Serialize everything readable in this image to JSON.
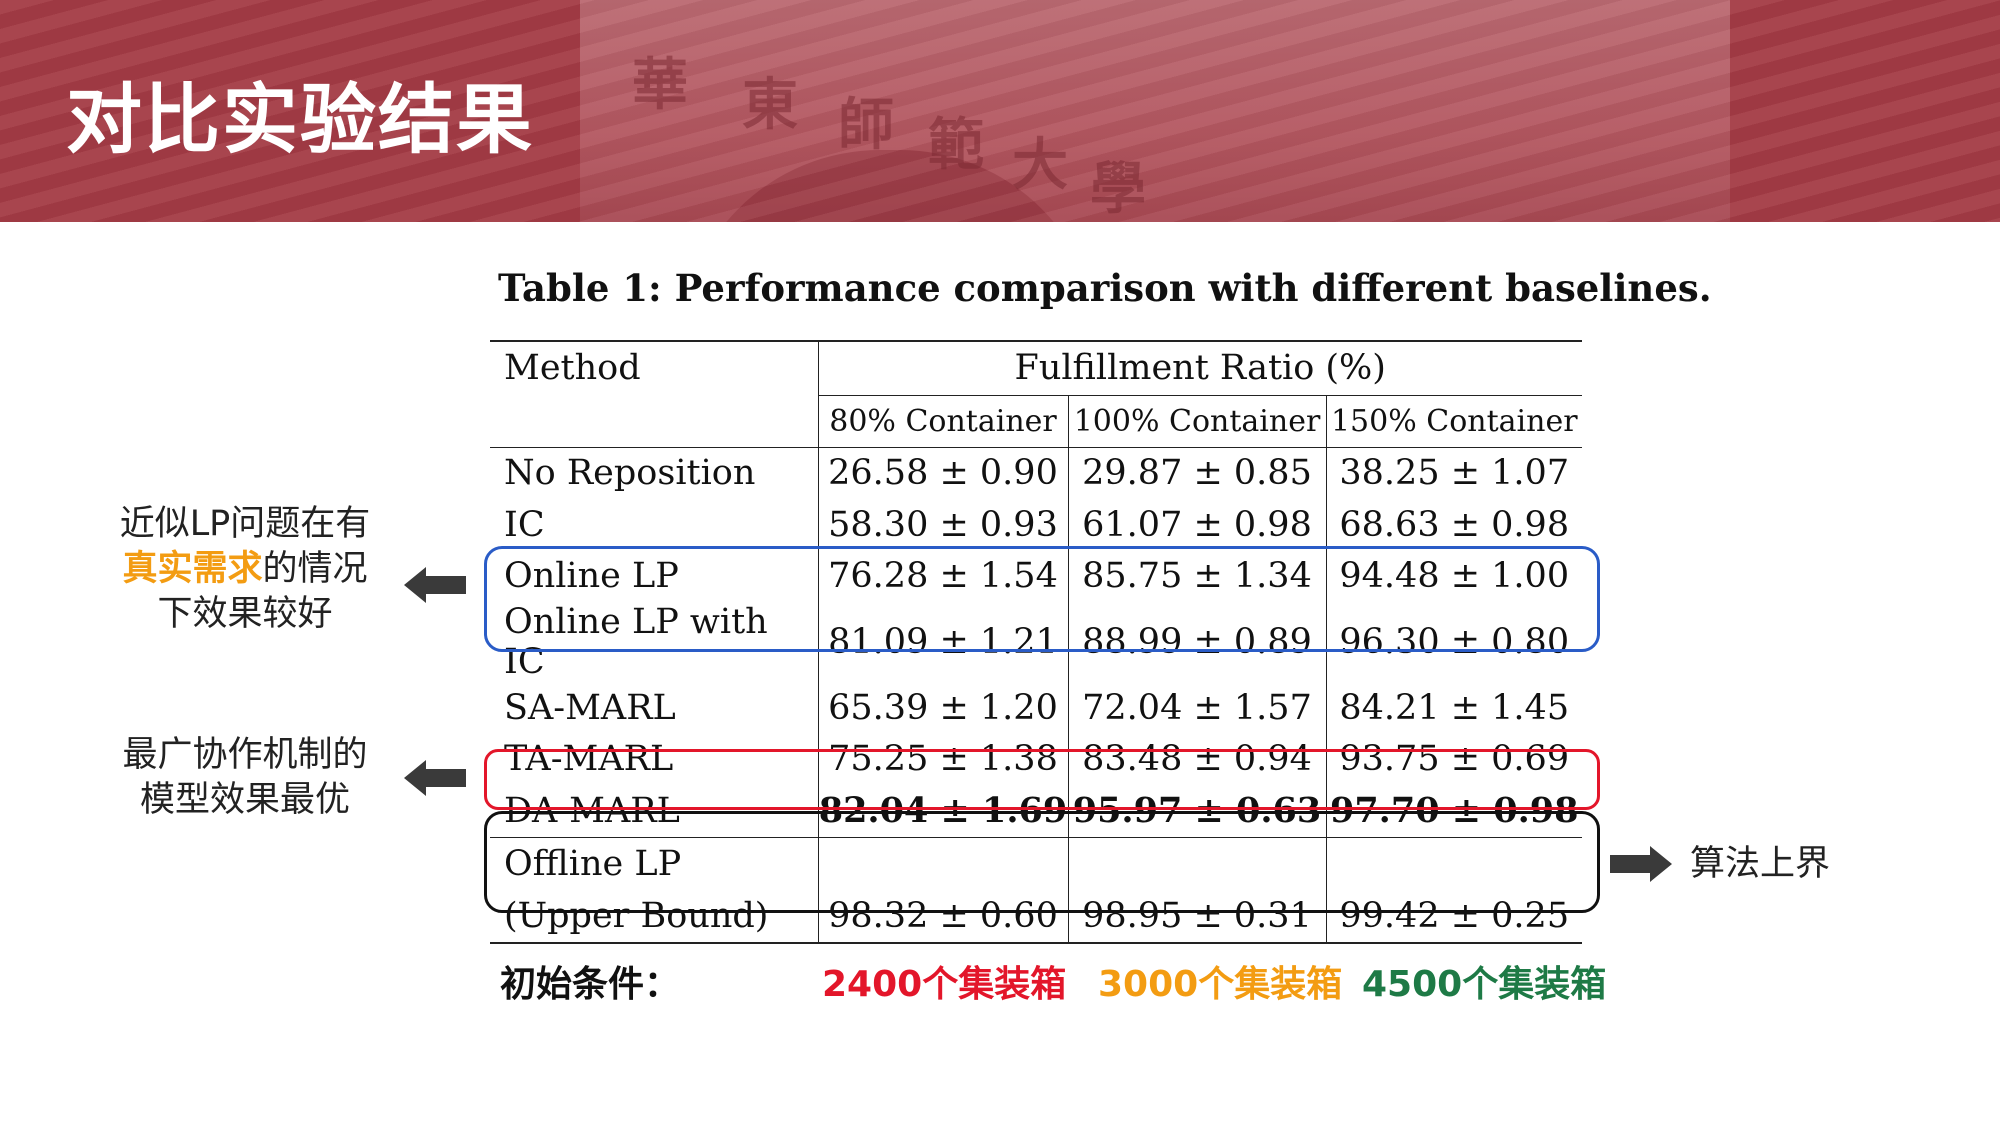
{
  "header": {
    "title": "对比实验结果",
    "carved_chars": [
      "華",
      "東",
      "師",
      "範",
      "大",
      "學"
    ]
  },
  "table": {
    "caption": "Table 1: Performance comparison with different baselines.",
    "method_header": "Method",
    "ratio_header": "Fulfillment Ratio (%)",
    "columns": [
      "80% Container",
      "100% Container",
      "150% Container"
    ],
    "rows": [
      {
        "method": "No Reposition",
        "values": [
          "26.58 ± 0.90",
          "29.87 ± 0.85",
          "38.25 ± 1.07"
        ]
      },
      {
        "method": "IC",
        "values": [
          "58.30 ± 0.93",
          "61.07 ± 0.98",
          "68.63 ± 0.98"
        ]
      },
      {
        "method": "Online LP",
        "values": [
          "76.28 ± 1.54",
          "85.75 ± 1.34",
          "94.48 ± 1.00"
        ]
      },
      {
        "method": "Online LP with IC",
        "values": [
          "81.09 ± 1.21",
          "88.99 ± 0.89",
          "96.30 ± 0.80"
        ]
      },
      {
        "method": "SA-MARL",
        "values": [
          "65.39 ± 1.20",
          "72.04 ± 1.57",
          "84.21 ± 1.45"
        ]
      },
      {
        "method": "TA-MARL",
        "values": [
          "75.25 ± 1.38",
          "83.48 ± 0.94",
          "93.75 ± 0.69"
        ]
      },
      {
        "method": "DA-MARL",
        "values": [
          "82.04 ± 1.69",
          "95.97 ± 0.63",
          "97.70 ± 0.98"
        ],
        "bold": true
      },
      {
        "method_lines": [
          "Offline LP",
          "(Upper Bound)"
        ],
        "values": [
          "98.32 ± 0.60",
          "98.95 ± 0.31",
          "99.42 ± 0.25"
        ]
      }
    ]
  },
  "annotations": {
    "note1": {
      "line1": "近似LP问题在有",
      "line2_hl": "真实需求",
      "line2_rest": "的情况",
      "line3": "下效果较好"
    },
    "note2": {
      "line1": "最广协作机制的",
      "line2": "模型效果最优"
    },
    "note3": "算法上界"
  },
  "conditions": {
    "label": "初始条件：",
    "items": [
      "2400个集装箱",
      "3000个集装箱",
      "4500个集装箱"
    ]
  },
  "colors": {
    "banner": "#a33b45",
    "blue_box": "#2a5cc7",
    "red_box": "#e3162a",
    "black_box": "#111111",
    "orange": "#f39c12",
    "green": "#1e7a46"
  }
}
